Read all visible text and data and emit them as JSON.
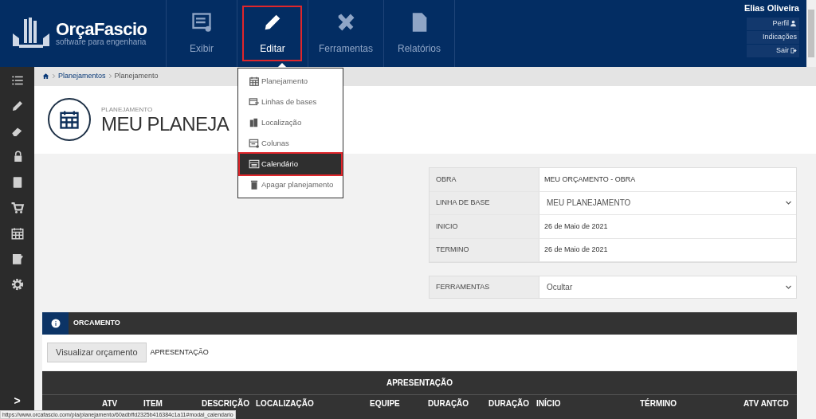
{
  "logo": {
    "name": "OrçaFascio",
    "tagline": "software para engenharia"
  },
  "nav": [
    {
      "label": "Exibir",
      "selected": false,
      "highlighted": false
    },
    {
      "label": "Editar",
      "selected": true,
      "highlighted": true
    },
    {
      "label": "Ferramentas",
      "selected": false,
      "highlighted": false
    },
    {
      "label": "Relatórios",
      "selected": false,
      "highlighted": false
    }
  ],
  "user": {
    "name": "Elias Oliveira",
    "links": [
      "Perfil",
      "Indicações",
      "Sair"
    ]
  },
  "sidebar": {
    "toggle": ">"
  },
  "breadcrumb": [
    "Planejamentos",
    "Planejamento"
  ],
  "header": {
    "subtitle": "PLANEJAMENTO",
    "title": "MEU PLANEJA"
  },
  "menu": [
    {
      "label": "Planejamento",
      "selected": false
    },
    {
      "label": "Linhas de bases",
      "selected": false
    },
    {
      "label": "Localização",
      "selected": false
    },
    {
      "label": "Colunas",
      "selected": false
    },
    {
      "label": "Calendário",
      "selected": true
    },
    {
      "label": "Apagar planejamento",
      "selected": false
    }
  ],
  "info": [
    {
      "label": "OBRA",
      "value": "MEU ORÇAMENTO - OBRA",
      "kind": "text"
    },
    {
      "label": "LINHA DE BASE",
      "value": "MEU PLANEJAMENTO",
      "kind": "select"
    },
    {
      "label": "INICIO",
      "value": "26 de Maio de 2021",
      "kind": "text"
    },
    {
      "label": "TERMINO",
      "value": "26 de Maio de 2021",
      "kind": "text"
    }
  ],
  "tools": {
    "label": "FERRAMENTAS",
    "value": "Ocultar"
  },
  "orcamento": {
    "title": "ORCAMENTO",
    "button": "Visualizar orçamento",
    "label": "APRESENTAÇÃO"
  },
  "table": {
    "title": "APRESENTAÇÃO",
    "columns": [
      "ATV",
      "ITEM",
      "DESCRIÇÃO",
      "LOCALIZAÇÃO",
      "EQUIPE",
      "DURAÇÃO",
      "DURAÇÃO",
      "INÍCIO",
      "TÉRMINO",
      "ATV ANTCD"
    ]
  },
  "status_bar": "https://www.orcafascio.com/pla/planejamento/60adbffd2325b416384c1a11#modal_calendario"
}
